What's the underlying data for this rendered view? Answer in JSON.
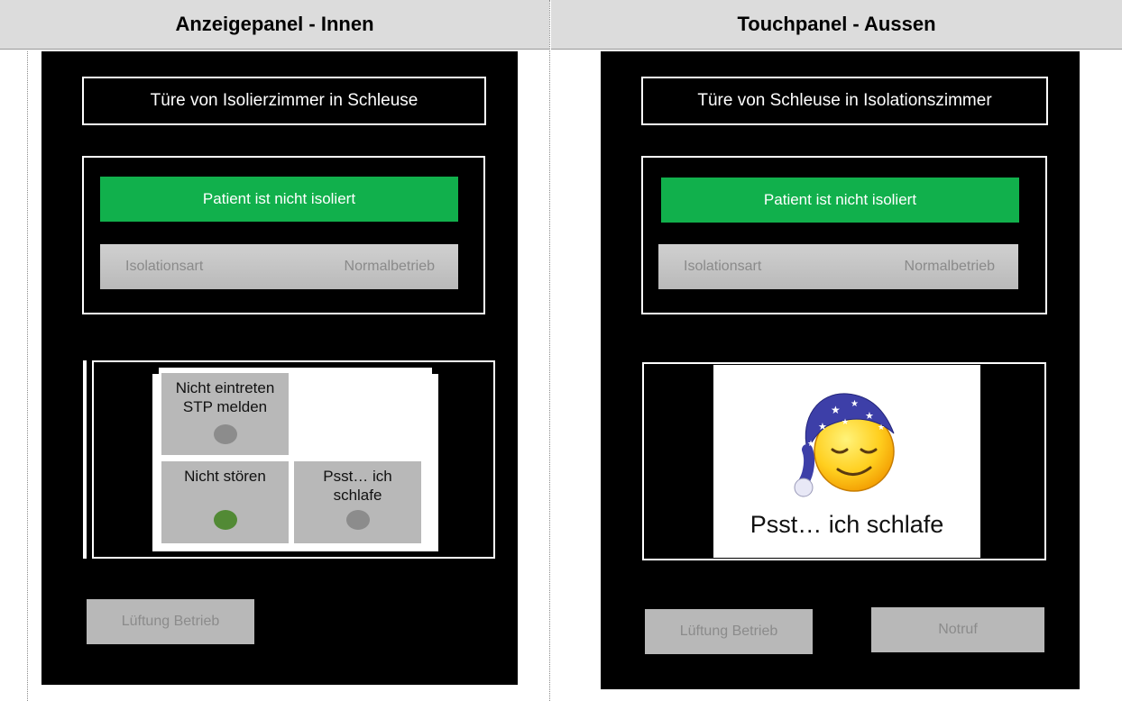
{
  "headers": {
    "left": "Anzeigepanel - Innen",
    "right": "Touchpanel - Aussen"
  },
  "left_panel": {
    "door_title": "Türe von Isolierzimmer in Schleuse",
    "status": "Patient ist nicht isoliert",
    "isolation_label": "Isolationsart",
    "isolation_value": "Normalbetrieb",
    "tiles": {
      "do_not_enter": "Nicht eintreten\nSTP melden",
      "do_not_disturb": "Nicht stören",
      "sleeping": "Psst… ich\nschlafe"
    },
    "tile_indicator_colors": {
      "do_not_enter": "#8c8c8c",
      "do_not_disturb": "#528a35",
      "sleeping": "#8c8c8c"
    },
    "ventilation_button": "Lüftung Betrieb"
  },
  "right_panel": {
    "door_title": "Türe von Schleuse in Isolationszimmer",
    "status": "Patient ist nicht isoliert",
    "isolation_label": "Isolationsart",
    "isolation_value": "Normalbetrieb",
    "sleep_caption": "Psst… ich schlafe",
    "ventilation_button": "Lüftung Betrieb",
    "emergency_button": "Notruf"
  },
  "icons": {
    "sleeping_emoji": "sleeping-smiley-icon"
  },
  "colors": {
    "status_green": "#11b04c",
    "panel_bg": "#000000",
    "button_gray": "#b8b8b8",
    "header_gray": "#dcdcdc"
  }
}
